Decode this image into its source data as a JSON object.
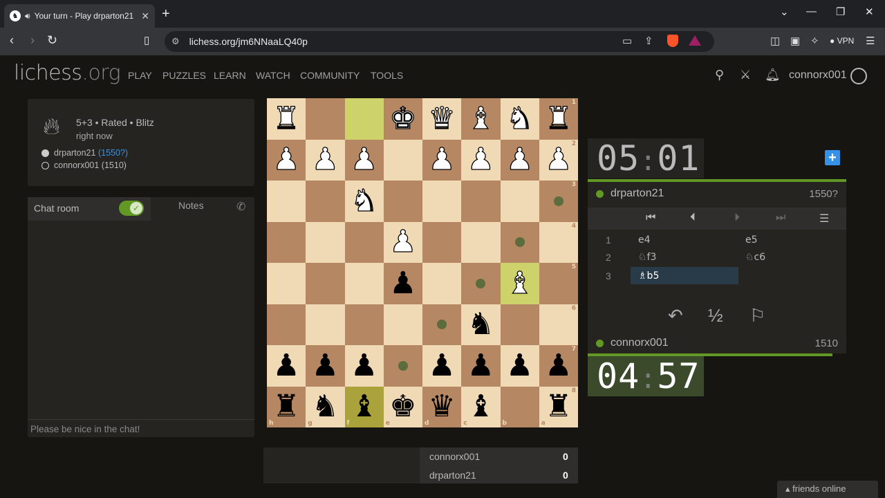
{
  "browser": {
    "tab_title": "Your turn - Play drparton21",
    "url": "lichess.org/jm6NNaaLQ40p",
    "vpn_label": "VPN"
  },
  "header": {
    "logo_main": "lichess",
    "logo_suffix": ".org",
    "nav": [
      "PLAY",
      "PUZZLES",
      "LEARN",
      "WATCH",
      "COMMUNITY",
      "TOOLS"
    ],
    "username": "connorx001"
  },
  "game_info": {
    "line1": "5+3 • Rated • Blitz",
    "line2": "right now",
    "white_player": "drparton21",
    "white_rating": "(1550?)",
    "black_player": "connorx001 (1510)"
  },
  "chat": {
    "tab_chat": "Chat room",
    "tab_notes": "Notes",
    "placeholder": "Please be nice in the chat!"
  },
  "board": {
    "rank_labels": [
      "1",
      "2",
      "3",
      "4",
      "5",
      "6",
      "7",
      "8"
    ],
    "file_labels": [
      "h",
      "g",
      "f",
      "e",
      "d",
      "c",
      "b",
      "a"
    ],
    "rows": [
      [
        "wR",
        "",
        "",
        "wK",
        "wQ",
        "wB",
        "wN",
        "wR"
      ],
      [
        "wP",
        "wP",
        "wP",
        "",
        "wP",
        "wP",
        "wP",
        "wP"
      ],
      [
        "",
        "",
        "wN",
        "",
        "",
        "",
        "",
        ""
      ],
      [
        "",
        "",
        "",
        "wP",
        "",
        "",
        "",
        ""
      ],
      [
        "",
        "",
        "",
        "bP",
        "",
        "",
        "wB",
        ""
      ],
      [
        "",
        "",
        "",
        "",
        "",
        "bN",
        "",
        ""
      ],
      [
        "bP",
        "bP",
        "bP",
        "",
        "bP",
        "bP",
        "bP",
        "bP"
      ],
      [
        "bR",
        "bN",
        "bB",
        "bK",
        "bQ",
        "bB",
        "",
        "bR"
      ]
    ]
  },
  "clocks": {
    "opponent_min": "05",
    "opponent_sec": "01",
    "player_min": "04",
    "player_sec": "57"
  },
  "opponent": {
    "name": "drparton21",
    "rating": "1550?"
  },
  "player": {
    "name": "connorx001",
    "rating": "1510"
  },
  "moves": [
    {
      "num": "1",
      "white": "e4",
      "black": "e5"
    },
    {
      "num": "2",
      "white": "♘f3",
      "black": "♘c6"
    },
    {
      "num": "3",
      "white": "♗b5",
      "black": ""
    }
  ],
  "draw_label": "½",
  "crosstable": [
    {
      "name": "connorx001",
      "score": "0"
    },
    {
      "name": "drparton21",
      "score": "0"
    }
  ],
  "friends_label": "friends online",
  "colors": {
    "accent_green": "#629924",
    "link_blue": "#3692e7",
    "board_light": "#f0d9b5",
    "board_dark": "#b58863"
  }
}
